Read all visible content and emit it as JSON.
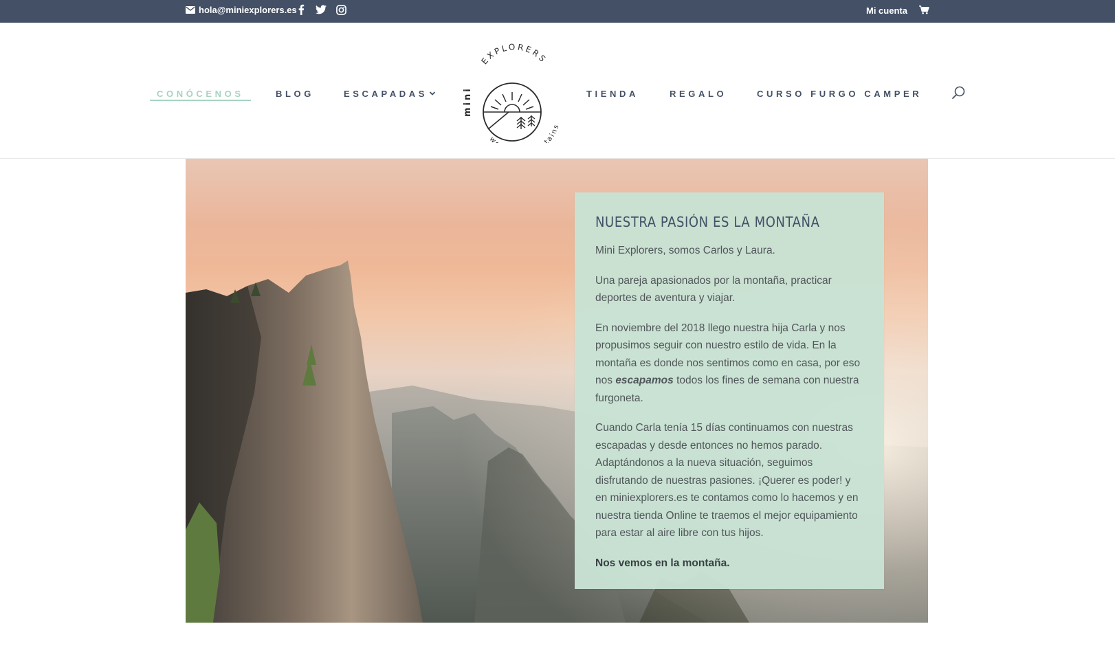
{
  "topbar": {
    "email": "hola@miniexplorers.es",
    "account_label": "Mi cuenta",
    "icons": [
      "mail-icon",
      "facebook-icon",
      "twitter-icon",
      "instagram-icon",
      "cart-icon"
    ]
  },
  "nav": {
    "items": [
      {
        "label": "CONÓCENOS"
      },
      {
        "label": "BLOG"
      },
      {
        "label": "ESCAPADAS"
      },
      {
        "label": "TIENDA"
      },
      {
        "label": "REGALO"
      },
      {
        "label": "CURSO FURGO CAMPER"
      }
    ],
    "active_color": "#a7d3c1",
    "text_color": "#435066"
  },
  "logo": {
    "arc_text": "EXPLORERS",
    "vertical_text": "mini",
    "bottom_text": "we love mountains"
  },
  "card": {
    "title": "NUESTRA PASIÓN ES LA MONTAÑA",
    "p1": "Mini Explorers, somos Carlos y Laura.",
    "p2": "Una pareja apasionados por la montaña, practicar deportes de aventura y viajar.",
    "p3_before": "En noviembre del 2018 llego nuestra hija Carla y nos propusimos seguir con nuestro estilo de vida. En la montaña es donde nos sentimos como en casa, por eso nos ",
    "p3_em": "escapamos",
    "p3_after": " todos los fines de semana con nuestra furgoneta.",
    "p4": "Cuando Carla tenía 15 días continuamos con nuestras escapadas y desde entonces no hemos parado. Adaptándonos a la nueva situación, seguimos disfrutando de nuestras pasiones. ¡Querer es poder! y en miniexplorers.es te contamos como lo hacemos y en nuestra tienda Online te traemos el mejor equipamiento para estar al aire libre con tus hijos.",
    "p5": "Nos vemos en la montaña.",
    "background": "#c8e2d4"
  },
  "colors": {
    "topbar": "#435066"
  }
}
